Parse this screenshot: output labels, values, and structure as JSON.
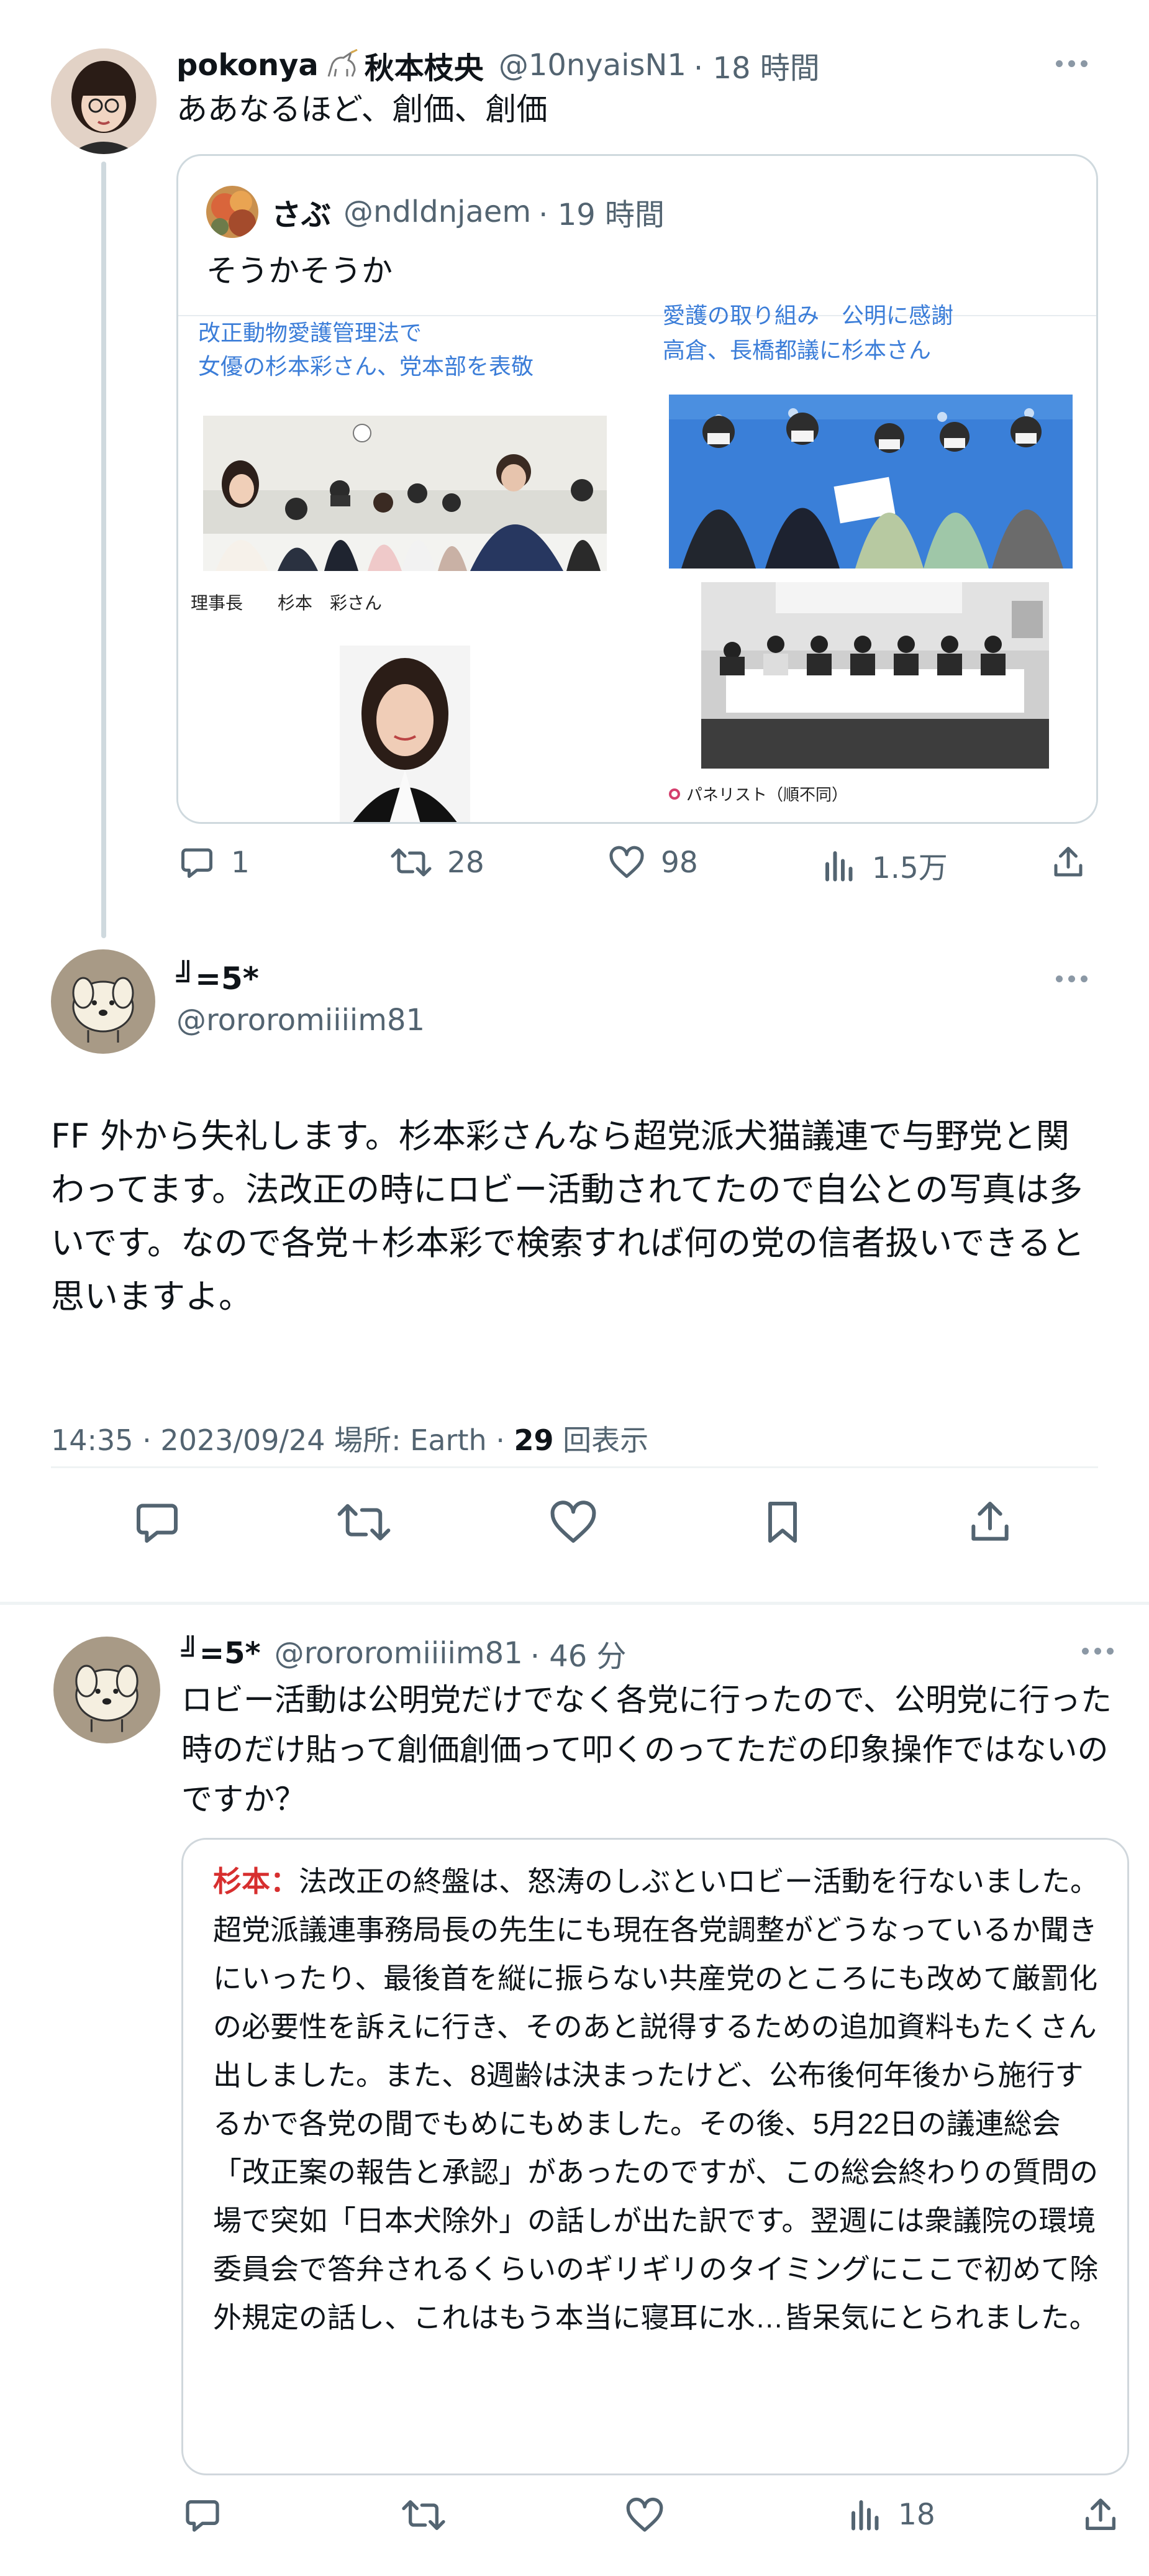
{
  "tweet1": {
    "display_name": "pokonya",
    "name_suffix": "秋本枝央",
    "handle": "@10nyaisN1",
    "time": "· 18 時間",
    "text": "ああなるほど、創価、創価",
    "quote": {
      "display_name": "さぶ",
      "handle": "@ndldnjaem",
      "time": "· 19 時間",
      "text": "そうかそうか",
      "image": {
        "left_heading_line1": "改正動物愛護管理法で",
        "left_heading_line2": "女優の杉本彩さん、党本部を表敬",
        "left_caption": "理事長　　杉本　彩さん",
        "right_heading_line1": "愛護の取り組み　公明に感謝",
        "right_heading_line2": "高倉、長橋都議に杉本さん",
        "right_caption": "パネリスト（順不同）"
      }
    },
    "stats": {
      "replies": "1",
      "retweets": "28",
      "likes": "98",
      "views": "1.5万"
    }
  },
  "tweet2": {
    "display_name": "╝=5*",
    "handle": "@rororomiiiim81",
    "text": "FF 外から失礼します。杉本彩さんなら超党派犬猫議連で与野党と関わってます。法改正の時にロビー活動されてたので自公との写真は多いです。なので各党＋杉本彩で検索すれば何の党の信者扱いできると思いますよ。",
    "meta_time": "14:35 · 2023/09/24 場所: Earth · ",
    "meta_views_count": "29",
    "meta_views_label": " 回表示"
  },
  "tweet3": {
    "display_name": "╝=5*",
    "handle": "@rororomiiiim81",
    "time": "· 46 分",
    "text": "ロビー活動は公明党だけでなく各党に行ったので、公明党に行った時のだけ貼って創価創価って叩くのってただの印象操作ではないのですか？",
    "quote_speaker": "杉本：",
    "quote_text": "法改正の終盤は、怒涛のしぶといロビー活動を行ないました。超党派議連事務局長の先生にも現在各党調整がどうなっているか聞きにいったり、最後首を縦に振らない共産党のところにも改めて厳罰化の必要性を訴えに行き、そのあと説得するための追加資料もたくさん出しました。また、8週齢は決まったけど、公布後何年後から施行するかで各党の間でもめにもめました。その後、5月22日の議連総会「改正案の報告と承認」があったのですが、この総会終わりの質問の場で突如「日本犬除外」の話しが出た訳です。翌週には衆議院の環境委員会で答弁されるくらいのギリギリのタイミングにここで初めて除外規定の話し、これはもう本当に寝耳に水…皆呆気にとられました。",
    "stats": {
      "views": "18"
    }
  },
  "colors": {
    "text": "#0f1419",
    "muted": "#536471",
    "border": "#cfd9de",
    "link_blue": "#3b7dd8",
    "quote_red": "#d72f2f"
  },
  "icons": [
    "reply-icon",
    "retweet-icon",
    "like-icon",
    "views-icon",
    "share-icon",
    "bookmark-icon",
    "more-icon"
  ]
}
